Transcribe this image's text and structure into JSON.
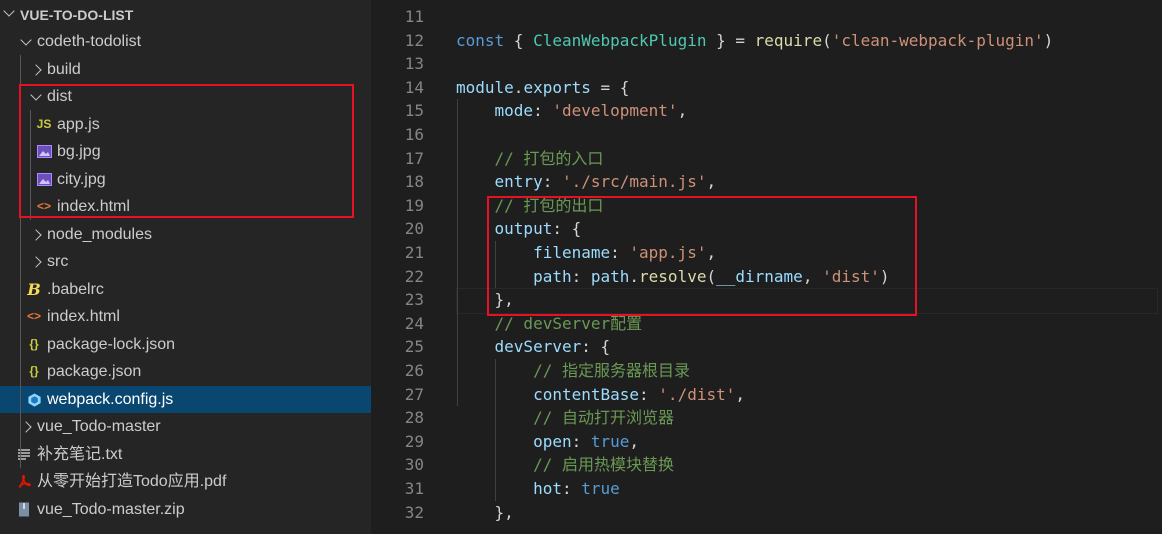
{
  "explorer": {
    "root_title": "VUE-TO-DO-LIST",
    "items": [
      {
        "label": "codeth-todolist",
        "depth": 1,
        "type": "folder",
        "open": true
      },
      {
        "label": "build",
        "depth": 2,
        "type": "folder",
        "open": false
      },
      {
        "label": "dist",
        "depth": 2,
        "type": "folder",
        "open": true
      },
      {
        "label": "app.js",
        "depth": 3,
        "type": "js",
        "icon": "JS"
      },
      {
        "label": "bg.jpg",
        "depth": 3,
        "type": "image"
      },
      {
        "label": "city.jpg",
        "depth": 3,
        "type": "image"
      },
      {
        "label": "index.html",
        "depth": 3,
        "type": "html",
        "icon": "<>"
      },
      {
        "label": "node_modules",
        "depth": 2,
        "type": "folder",
        "open": false
      },
      {
        "label": "src",
        "depth": 2,
        "type": "folder",
        "open": false
      },
      {
        "label": ".babelrc",
        "depth": 2,
        "type": "babel",
        "icon": "B"
      },
      {
        "label": "index.html",
        "depth": 2,
        "type": "html",
        "icon": "<>"
      },
      {
        "label": "package-lock.json",
        "depth": 2,
        "type": "json",
        "icon": "{}"
      },
      {
        "label": "package.json",
        "depth": 2,
        "type": "json",
        "icon": "{}"
      },
      {
        "label": "webpack.config.js",
        "depth": 2,
        "type": "webpack",
        "selected": true
      },
      {
        "label": "vue_Todo-master",
        "depth": 1,
        "type": "folder",
        "open": false
      },
      {
        "label": "补充笔记.txt",
        "depth": 1,
        "type": "txt"
      },
      {
        "label": "从零开始打造Todo应用.pdf",
        "depth": 1,
        "type": "pdf"
      },
      {
        "label": "vue_Todo-master.zip",
        "depth": 1,
        "type": "zip"
      }
    ]
  },
  "editor": {
    "lines": [
      {
        "n": "11",
        "code": ""
      },
      {
        "n": "12",
        "code": "const { CleanWebpackPlugin } = require('clean-webpack-plugin')"
      },
      {
        "n": "13",
        "code": ""
      },
      {
        "n": "14",
        "code": "module.exports = {"
      },
      {
        "n": "15",
        "code": "    mode: 'development',"
      },
      {
        "n": "16",
        "code": ""
      },
      {
        "n": "17",
        "code": "    // 打包的入口"
      },
      {
        "n": "18",
        "code": "    entry: './src/main.js',"
      },
      {
        "n": "19",
        "code": "    // 打包的出口"
      },
      {
        "n": "20",
        "code": "    output: {"
      },
      {
        "n": "21",
        "code": "        filename: 'app.js',"
      },
      {
        "n": "22",
        "code": "        path: path.resolve(__dirname, 'dist')"
      },
      {
        "n": "23",
        "code": "    },"
      },
      {
        "n": "24",
        "code": "    // devServer配置"
      },
      {
        "n": "25",
        "code": "    devServer: {"
      },
      {
        "n": "26",
        "code": "        // 指定服务器根目录"
      },
      {
        "n": "27",
        "code": "        contentBase: './dist',"
      },
      {
        "n": "28",
        "code": "        // 自动打开浏览器"
      },
      {
        "n": "29",
        "code": "        open: true,"
      },
      {
        "n": "30",
        "code": "        // 启用热模块替换"
      },
      {
        "n": "31",
        "code": "        hot: true"
      },
      {
        "n": "32",
        "code": "    },"
      }
    ]
  },
  "colors": {
    "sidebar_bg": "#252526",
    "editor_bg": "#1e1e1e",
    "selection_bg": "#094771",
    "highlight_box": "#e81123",
    "keyword": "#569cd6",
    "string": "#ce9178",
    "comment": "#6a9955",
    "property": "#9cdcfe",
    "function": "#dcdcaa",
    "class": "#4ec9b0"
  }
}
